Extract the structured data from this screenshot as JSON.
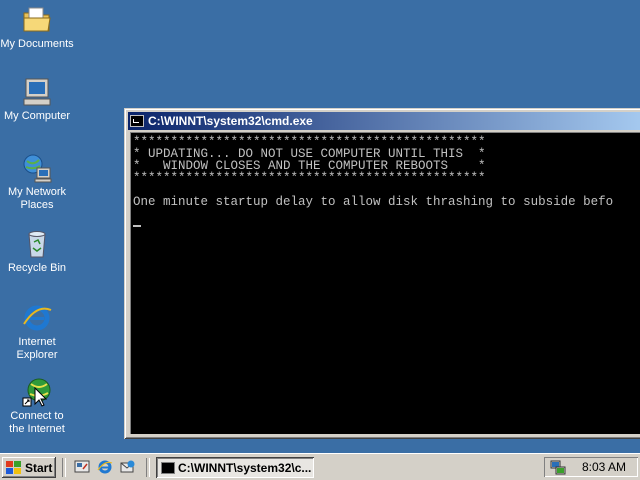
{
  "desktop": {
    "icons": [
      {
        "label_lines": [
          "My Documents"
        ],
        "icon": "folder-icon"
      },
      {
        "label_lines": [
          "My Computer"
        ],
        "icon": "computer-icon"
      },
      {
        "label_lines": [
          "My Network",
          "Places"
        ],
        "icon": "network-icon"
      },
      {
        "label_lines": [
          "Recycle Bin"
        ],
        "icon": "recycle-bin-icon"
      },
      {
        "label_lines": [
          "Internet",
          "Explorer"
        ],
        "icon": "internet-explorer-icon"
      },
      {
        "label_lines": [
          "Connect to",
          "the Internet"
        ],
        "icon": "connect-internet-icon"
      }
    ],
    "background_color": "#3a6ea5"
  },
  "window": {
    "title": "C:\\WINNT\\system32\\cmd.exe",
    "console_lines": [
      "***********************************************",
      "* UPDATING... DO NOT USE COMPUTER UNTIL THIS  *",
      "*   WINDOW CLOSES AND THE COMPUTER REBOOTS    *",
      "***********************************************",
      "",
      "One minute startup delay to allow disk thrashing to subside befo",
      ""
    ]
  },
  "taskbar": {
    "start_label": "Start",
    "task_label": "C:\\WINNT\\system32\\c...",
    "clock": "8:03 AM",
    "quick_launch": [
      "show-desktop-icon",
      "internet-explorer-icon",
      "outlook-express-icon"
    ]
  }
}
